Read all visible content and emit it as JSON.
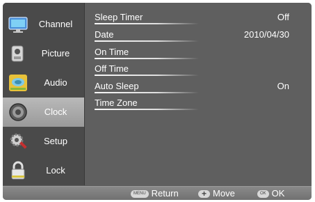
{
  "sidebar": {
    "items": [
      {
        "label": "Channel",
        "icon": "channel-monitor-icon"
      },
      {
        "label": "Picture",
        "icon": "picture-camera-icon"
      },
      {
        "label": "Audio",
        "icon": "audio-icon"
      },
      {
        "label": "Clock",
        "icon": "clock-icon",
        "active": true
      },
      {
        "label": "Setup",
        "icon": "setup-gear-icon"
      },
      {
        "label": "Lock",
        "icon": "lock-icon"
      }
    ]
  },
  "settings": [
    {
      "label": "Sleep Timer",
      "value": "Off"
    },
    {
      "label": "Date",
      "value": "2010/04/30"
    },
    {
      "label": "On Time",
      "value": ""
    },
    {
      "label": "Off Time",
      "value": ""
    },
    {
      "label": "Auto Sleep",
      "value": "On"
    },
    {
      "label": "Time Zone",
      "value": ""
    }
  ],
  "footer": {
    "return_key": "MENU",
    "return_label": "Return",
    "move_key": "+",
    "move_label": "Move",
    "ok_key": "OK",
    "ok_label": "OK"
  }
}
